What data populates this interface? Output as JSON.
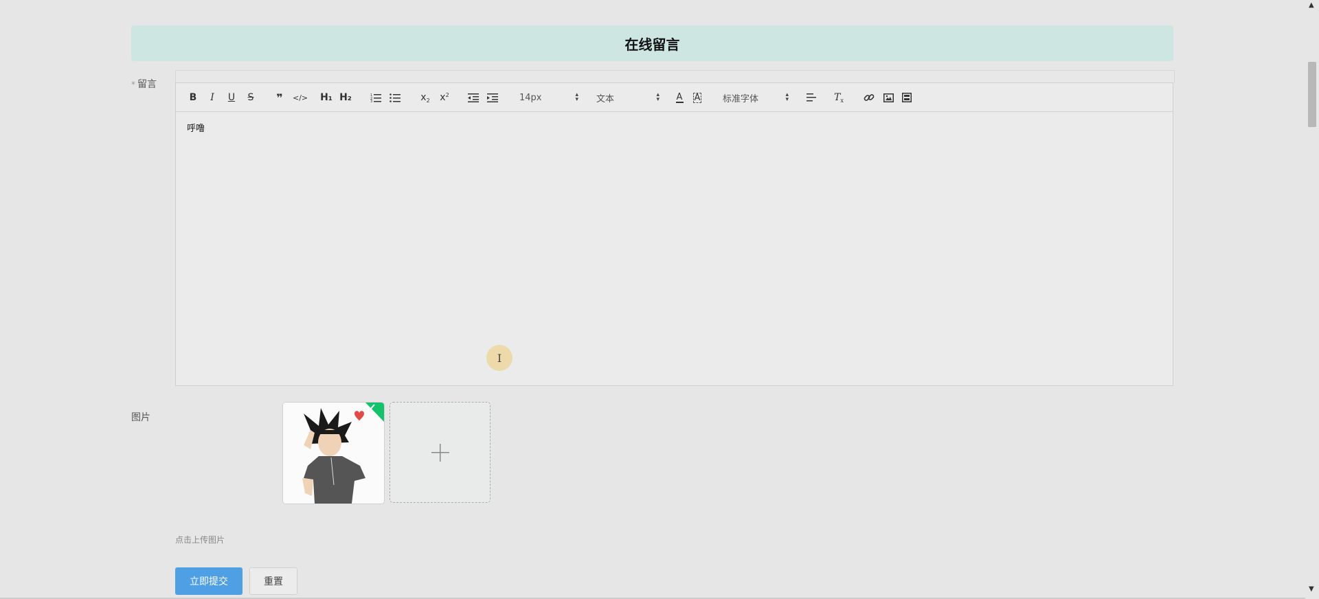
{
  "page": {
    "title": "在线留言"
  },
  "form": {
    "message_label": "留言",
    "required_mark": "*",
    "image_label": "图片",
    "upload_hint": "点击上传图片",
    "submit_label": "立即提交",
    "reset_label": "重置"
  },
  "editor": {
    "font_size": "14px",
    "header_select": "文本",
    "font_family": "标准字体",
    "content": "呼噜",
    "toolbar_labels": {
      "h1": "H₁",
      "h2": "H₂"
    },
    "icons": [
      "bold-icon",
      "italic-icon",
      "underline-icon",
      "strike-icon",
      "quote-icon",
      "code-icon",
      "h1-icon",
      "h2-icon",
      "ordered-list-icon",
      "bullet-list-icon",
      "subscript-icon",
      "superscript-icon",
      "outdent-icon",
      "indent-icon",
      "font-color-icon",
      "background-color-icon",
      "align-icon",
      "clear-format-icon",
      "link-icon",
      "image-icon",
      "video-icon"
    ]
  },
  "colors": {
    "title_bg": "#cde6e1",
    "primary": "#4e9fe4"
  }
}
